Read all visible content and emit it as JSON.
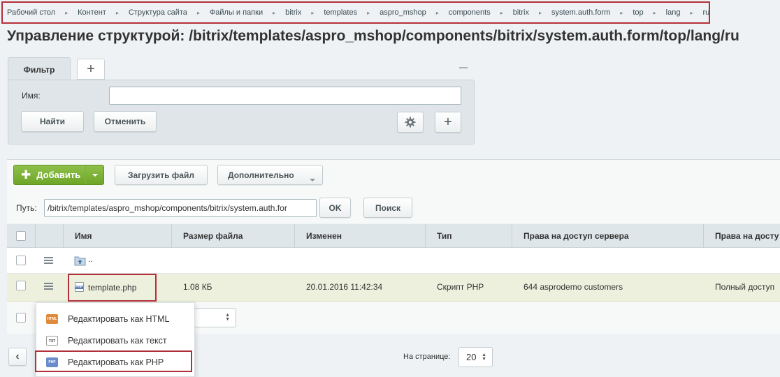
{
  "breadcrumb": [
    "Рабочий стол",
    "Контент",
    "Структура сайта",
    "Файлы и папки",
    "bitrix",
    "templates",
    "aspro_mshop",
    "components",
    "bitrix",
    "system.auth.form",
    "top",
    "lang",
    "ru"
  ],
  "page_title": "Управление структурой: /bitrix/templates/aspro_mshop/components/bitrix/system.auth.form/top/lang/ru",
  "filter": {
    "tab_label": "Фильтр",
    "add_tab": "+",
    "name_label": "Имя:",
    "name_value": "",
    "find_button": "Найти",
    "cancel_button": "Отменить",
    "add_field_button": "+"
  },
  "toolbar": {
    "add_button": "Добавить",
    "upload_button": "Загрузить файл",
    "more_button": "Дополнительно"
  },
  "path": {
    "label": "Путь:",
    "value": "/bitrix/templates/aspro_mshop/components/bitrix/system.auth.for",
    "ok_button": "OK",
    "search_button": "Поиск"
  },
  "table": {
    "columns": [
      "Имя",
      "Размер файла",
      "Изменен",
      "Тип",
      "Права на доступ сервера",
      "Права на досту"
    ],
    "up_row": {
      "name": ".."
    },
    "rows": [
      {
        "name": "template.php",
        "size": "1.08 КБ",
        "modified": "20.01.2016 11:42:34",
        "type": "Скрипт PHP",
        "server_rights": "644 asprodemo customers",
        "access": "Полный доступ"
      }
    ]
  },
  "context_menu": {
    "items": [
      {
        "label": "Редактировать как HTML",
        "icon": "html"
      },
      {
        "label": "Редактировать как текст",
        "icon": "txt"
      },
      {
        "label": "Редактировать как PHP",
        "icon": "php"
      }
    ]
  },
  "pagination": {
    "per_page_label": "На странице:",
    "per_page_value": "20",
    "prev": "‹"
  },
  "colors": {
    "highlight_border": "#b3303a",
    "add_button_green": "#6ea628",
    "selected_row": "#eef0de"
  }
}
